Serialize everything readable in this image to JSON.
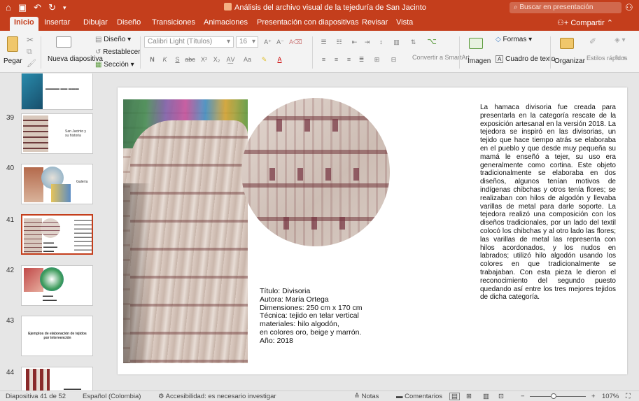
{
  "window": {
    "title": "Análisis del archivo visual de la tejeduría de San Jacinto",
    "search_placeholder": "Buscar en presentación"
  },
  "tabs": [
    "Inicio",
    "Insertar",
    "Dibujar",
    "Diseño",
    "Transiciones",
    "Animaciones",
    "Presentación con diapositivas",
    "Revisar",
    "Vista"
  ],
  "share_label": "Compartir",
  "ribbon": {
    "paste": "Pegar",
    "new_slide": "Nueva diapositiva",
    "design": "Diseño",
    "reset": "Restablecer",
    "section": "Sección",
    "font_name": "Calibri Light (Títulos)",
    "font_size": "16",
    "convert_smartart": "Convertir a SmartArt",
    "image": "Imagen",
    "shapes": "Formas",
    "textbox": "Cuadro de texto",
    "arrange": "Organizar",
    "quick_styles": "Estilos rápidos"
  },
  "thumbnails": [
    {
      "num": "",
      "caption": ""
    },
    {
      "num": "39",
      "caption": "San Jacinto y su historia"
    },
    {
      "num": "40",
      "caption": "Galería"
    },
    {
      "num": "41",
      "caption": ""
    },
    {
      "num": "42",
      "caption": ""
    },
    {
      "num": "43",
      "caption": "Ejemplos de elaboración de tejidos por intervención"
    },
    {
      "num": "44",
      "caption": ""
    }
  ],
  "slide": {
    "caption_lines": [
      "Título: Divisoria",
      "Autora: María Ortega",
      "Dimensiones: 250 cm x 170 cm",
      "Técnica: tejido en telar vertical",
      "materiales: hilo algodón,",
      "en colores oro, beige y marrón.",
      "Año: 2018"
    ],
    "body": "La hamaca divisoria fue creada para presentarla en la categoría rescate de la exposición artesanal en la versión 2018. La tejedora se inspiró en las divisorias, un tejido que hace tiempo atrás se elaboraba en el pueblo y que desde muy pequeña su mamá le enseñó a tejer, su uso era generalmente como cortina. Este objeto tradicionalmente se elaboraba en dos diseños, algunos tenían motivos de indígenas chibchas y otros tenía flores; se realizaban con hilos de algodón y llevaba varillas de metal para darle soporte. La tejedora realizó una composición con los diseños tradicionales, por un lado del textil colocó los chibchas y al otro lado las flores; las varillas de metal las representa con hilos acordonados, y los nudos en labrados; utilizó hilo algodón usando los colores en que tradicionalmente se trabajaban. Con esta pieza le dieron el reconocimiento del segundo puesto quedando así entre los tres mejores tejidos de dicha categoría."
  },
  "status": {
    "slide_info": "Diapositiva 41 de 52",
    "language": "Español (Colombia)",
    "accessibility": "Accesibilidad: es necesario investigar",
    "notes": "Notas",
    "comments": "Comentarios",
    "zoom": "107%"
  }
}
